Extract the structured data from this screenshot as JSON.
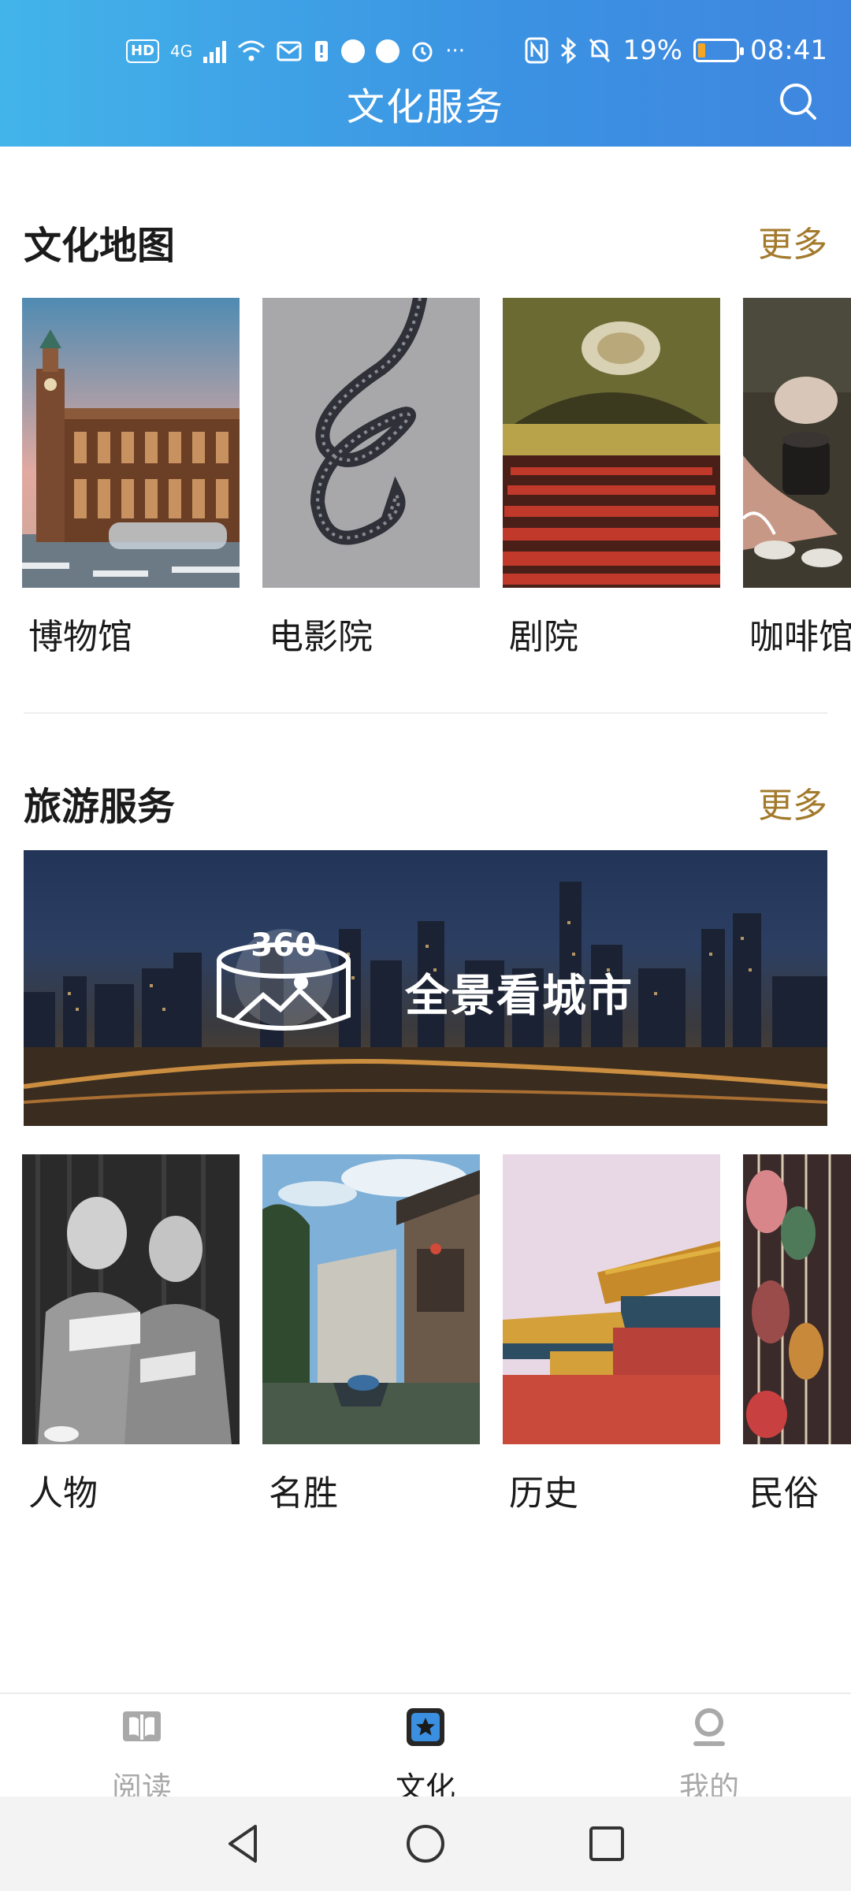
{
  "status_bar": {
    "left_chip": "HD",
    "network": "4G",
    "more": "···",
    "battery_text": "19%",
    "battery_level": 0.19,
    "time": "08:41"
  },
  "header": {
    "title": "文化服务"
  },
  "culture_map": {
    "title": "文化地图",
    "more": "更多",
    "items": [
      {
        "label": "博物馆"
      },
      {
        "label": "电影院"
      },
      {
        "label": "剧院"
      },
      {
        "label": "咖啡馆"
      }
    ]
  },
  "tourism": {
    "title": "旅游服务",
    "more": "更多",
    "banner": {
      "badge": "360",
      "text": "全景看城市"
    },
    "items": [
      {
        "label": "人物"
      },
      {
        "label": "名胜"
      },
      {
        "label": "历史"
      },
      {
        "label": "民俗"
      }
    ]
  },
  "bottom_nav": {
    "items": [
      {
        "label": "阅读",
        "icon": "book-icon"
      },
      {
        "label": "文化",
        "icon": "star-square-icon",
        "active": true
      },
      {
        "label": "我的",
        "icon": "person-icon"
      }
    ]
  },
  "colors": {
    "header_start": "#43b4ea",
    "header_end": "#3f86e0",
    "more_link": "#a37a2c",
    "active_nav": "#1a1a1a",
    "inactive_nav": "#a9a9a9"
  }
}
